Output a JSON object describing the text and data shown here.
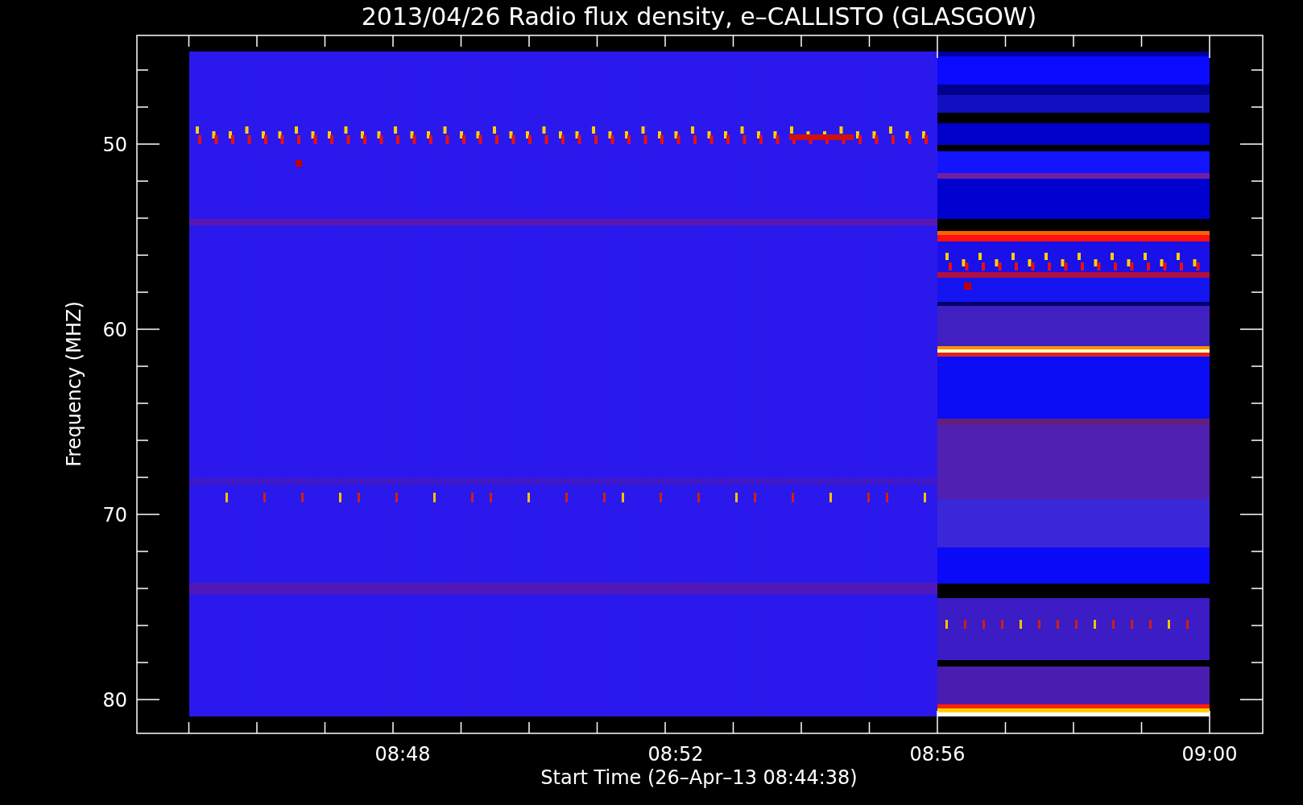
{
  "plot": {
    "title": "2013/04/26  Radio flux density, e–CALLISTO (GLASGOW)",
    "y_axis": {
      "label": "Frequency (MHZ)",
      "ticks": [
        "50",
        "60",
        "70",
        "80"
      ]
    },
    "x_axis": {
      "label": "Start Time (26–Apr–13 08:44:38)",
      "ticks": [
        "08:48",
        "08:52",
        "08:56",
        "09:00"
      ]
    }
  }
}
